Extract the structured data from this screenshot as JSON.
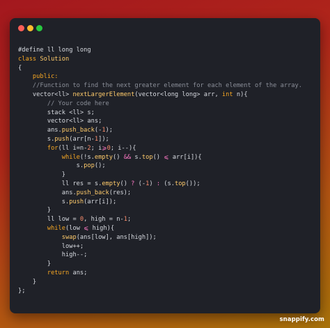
{
  "window": {
    "controls": [
      "close",
      "minimize",
      "maximize"
    ],
    "colors": {
      "close": "#ff5f57",
      "minimize": "#febc2e",
      "maximize": "#28c840"
    }
  },
  "code": {
    "language": "cpp",
    "lines": [
      [
        {
          "t": "#define ll long long",
          "c": "pp"
        }
      ],
      [
        {
          "t": "class",
          "c": "kw"
        },
        {
          "t": " ",
          "c": ""
        },
        {
          "t": "Solution",
          "c": "fn"
        }
      ],
      [
        {
          "t": "{",
          "c": ""
        }
      ],
      [
        {
          "t": "    ",
          "c": ""
        },
        {
          "t": "public:",
          "c": "kw"
        }
      ],
      [
        {
          "t": "    ",
          "c": ""
        },
        {
          "t": "//Function to find the next greater element for each element of the array.",
          "c": "cm"
        }
      ],
      [
        {
          "t": "    vector<ll> ",
          "c": ""
        },
        {
          "t": "nextLargerElement",
          "c": "fn"
        },
        {
          "t": "(vector<long long> arr, ",
          "c": ""
        },
        {
          "t": "int",
          "c": "kw"
        },
        {
          "t": " n){",
          "c": ""
        }
      ],
      [
        {
          "t": "        ",
          "c": ""
        },
        {
          "t": "// Your code here",
          "c": "cm"
        }
      ],
      [
        {
          "t": "        stack <ll> s;",
          "c": ""
        }
      ],
      [
        {
          "t": "        vector<ll> ans;",
          "c": ""
        }
      ],
      [
        {
          "t": "        ans.",
          "c": ""
        },
        {
          "t": "push_back",
          "c": "fn"
        },
        {
          "t": "(-",
          "c": ""
        },
        {
          "t": "1",
          "c": "num"
        },
        {
          "t": ");",
          "c": ""
        }
      ],
      [
        {
          "t": "        s.",
          "c": ""
        },
        {
          "t": "push",
          "c": "fn"
        },
        {
          "t": "(arr[n-",
          "c": ""
        },
        {
          "t": "1",
          "c": "num"
        },
        {
          "t": "]);",
          "c": ""
        }
      ],
      [
        {
          "t": "        ",
          "c": ""
        },
        {
          "t": "for",
          "c": "kw"
        },
        {
          "t": "(ll i=n-",
          "c": ""
        },
        {
          "t": "2",
          "c": "num"
        },
        {
          "t": "; i",
          "c": ""
        },
        {
          "t": "⩾",
          "c": "op"
        },
        {
          "t": "0",
          "c": "num"
        },
        {
          "t": "; i--){",
          "c": ""
        }
      ],
      [
        {
          "t": "            ",
          "c": ""
        },
        {
          "t": "while",
          "c": "kw"
        },
        {
          "t": "(!s.",
          "c": ""
        },
        {
          "t": "empty",
          "c": "fn"
        },
        {
          "t": "() ",
          "c": ""
        },
        {
          "t": "&&",
          "c": "op"
        },
        {
          "t": " s.",
          "c": ""
        },
        {
          "t": "top",
          "c": "fn"
        },
        {
          "t": "() ",
          "c": ""
        },
        {
          "t": "⩽",
          "c": "op"
        },
        {
          "t": " arr[i]){",
          "c": ""
        }
      ],
      [
        {
          "t": "                s.",
          "c": ""
        },
        {
          "t": "pop",
          "c": "fn"
        },
        {
          "t": "();",
          "c": ""
        }
      ],
      [
        {
          "t": "            }",
          "c": ""
        }
      ],
      [
        {
          "t": "            ll res = s.",
          "c": ""
        },
        {
          "t": "empty",
          "c": "fn"
        },
        {
          "t": "() ",
          "c": ""
        },
        {
          "t": "?",
          "c": "op"
        },
        {
          "t": " (-",
          "c": ""
        },
        {
          "t": "1",
          "c": "num"
        },
        {
          "t": ") ",
          "c": ""
        },
        {
          "t": ":",
          "c": "op"
        },
        {
          "t": " (s.",
          "c": ""
        },
        {
          "t": "top",
          "c": "fn"
        },
        {
          "t": "());",
          "c": ""
        }
      ],
      [
        {
          "t": "            ans.",
          "c": ""
        },
        {
          "t": "push_back",
          "c": "fn"
        },
        {
          "t": "(res);",
          "c": ""
        }
      ],
      [
        {
          "t": "            s.",
          "c": ""
        },
        {
          "t": "push",
          "c": "fn"
        },
        {
          "t": "(arr[i]);",
          "c": ""
        }
      ],
      [
        {
          "t": "        }",
          "c": ""
        }
      ],
      [
        {
          "t": "        ll low = ",
          "c": ""
        },
        {
          "t": "0",
          "c": "num"
        },
        {
          "t": ", high = n-",
          "c": ""
        },
        {
          "t": "1",
          "c": "num"
        },
        {
          "t": ";",
          "c": ""
        }
      ],
      [
        {
          "t": "        ",
          "c": ""
        },
        {
          "t": "while",
          "c": "kw"
        },
        {
          "t": "(low ",
          "c": ""
        },
        {
          "t": "⩽",
          "c": "op"
        },
        {
          "t": " high){",
          "c": ""
        }
      ],
      [
        {
          "t": "            ",
          "c": ""
        },
        {
          "t": "swap",
          "c": "fn"
        },
        {
          "t": "(ans[low], ans[high]);",
          "c": ""
        }
      ],
      [
        {
          "t": "            low++;",
          "c": ""
        }
      ],
      [
        {
          "t": "            high--;",
          "c": ""
        }
      ],
      [
        {
          "t": "        }",
          "c": ""
        }
      ],
      [
        {
          "t": "        ",
          "c": ""
        },
        {
          "t": "return",
          "c": "kw"
        },
        {
          "t": " ans;",
          "c": ""
        }
      ],
      [
        {
          "t": "    }",
          "c": ""
        }
      ],
      [
        {
          "t": "};",
          "c": ""
        }
      ]
    ]
  },
  "watermark": {
    "text": "snappify.com"
  }
}
